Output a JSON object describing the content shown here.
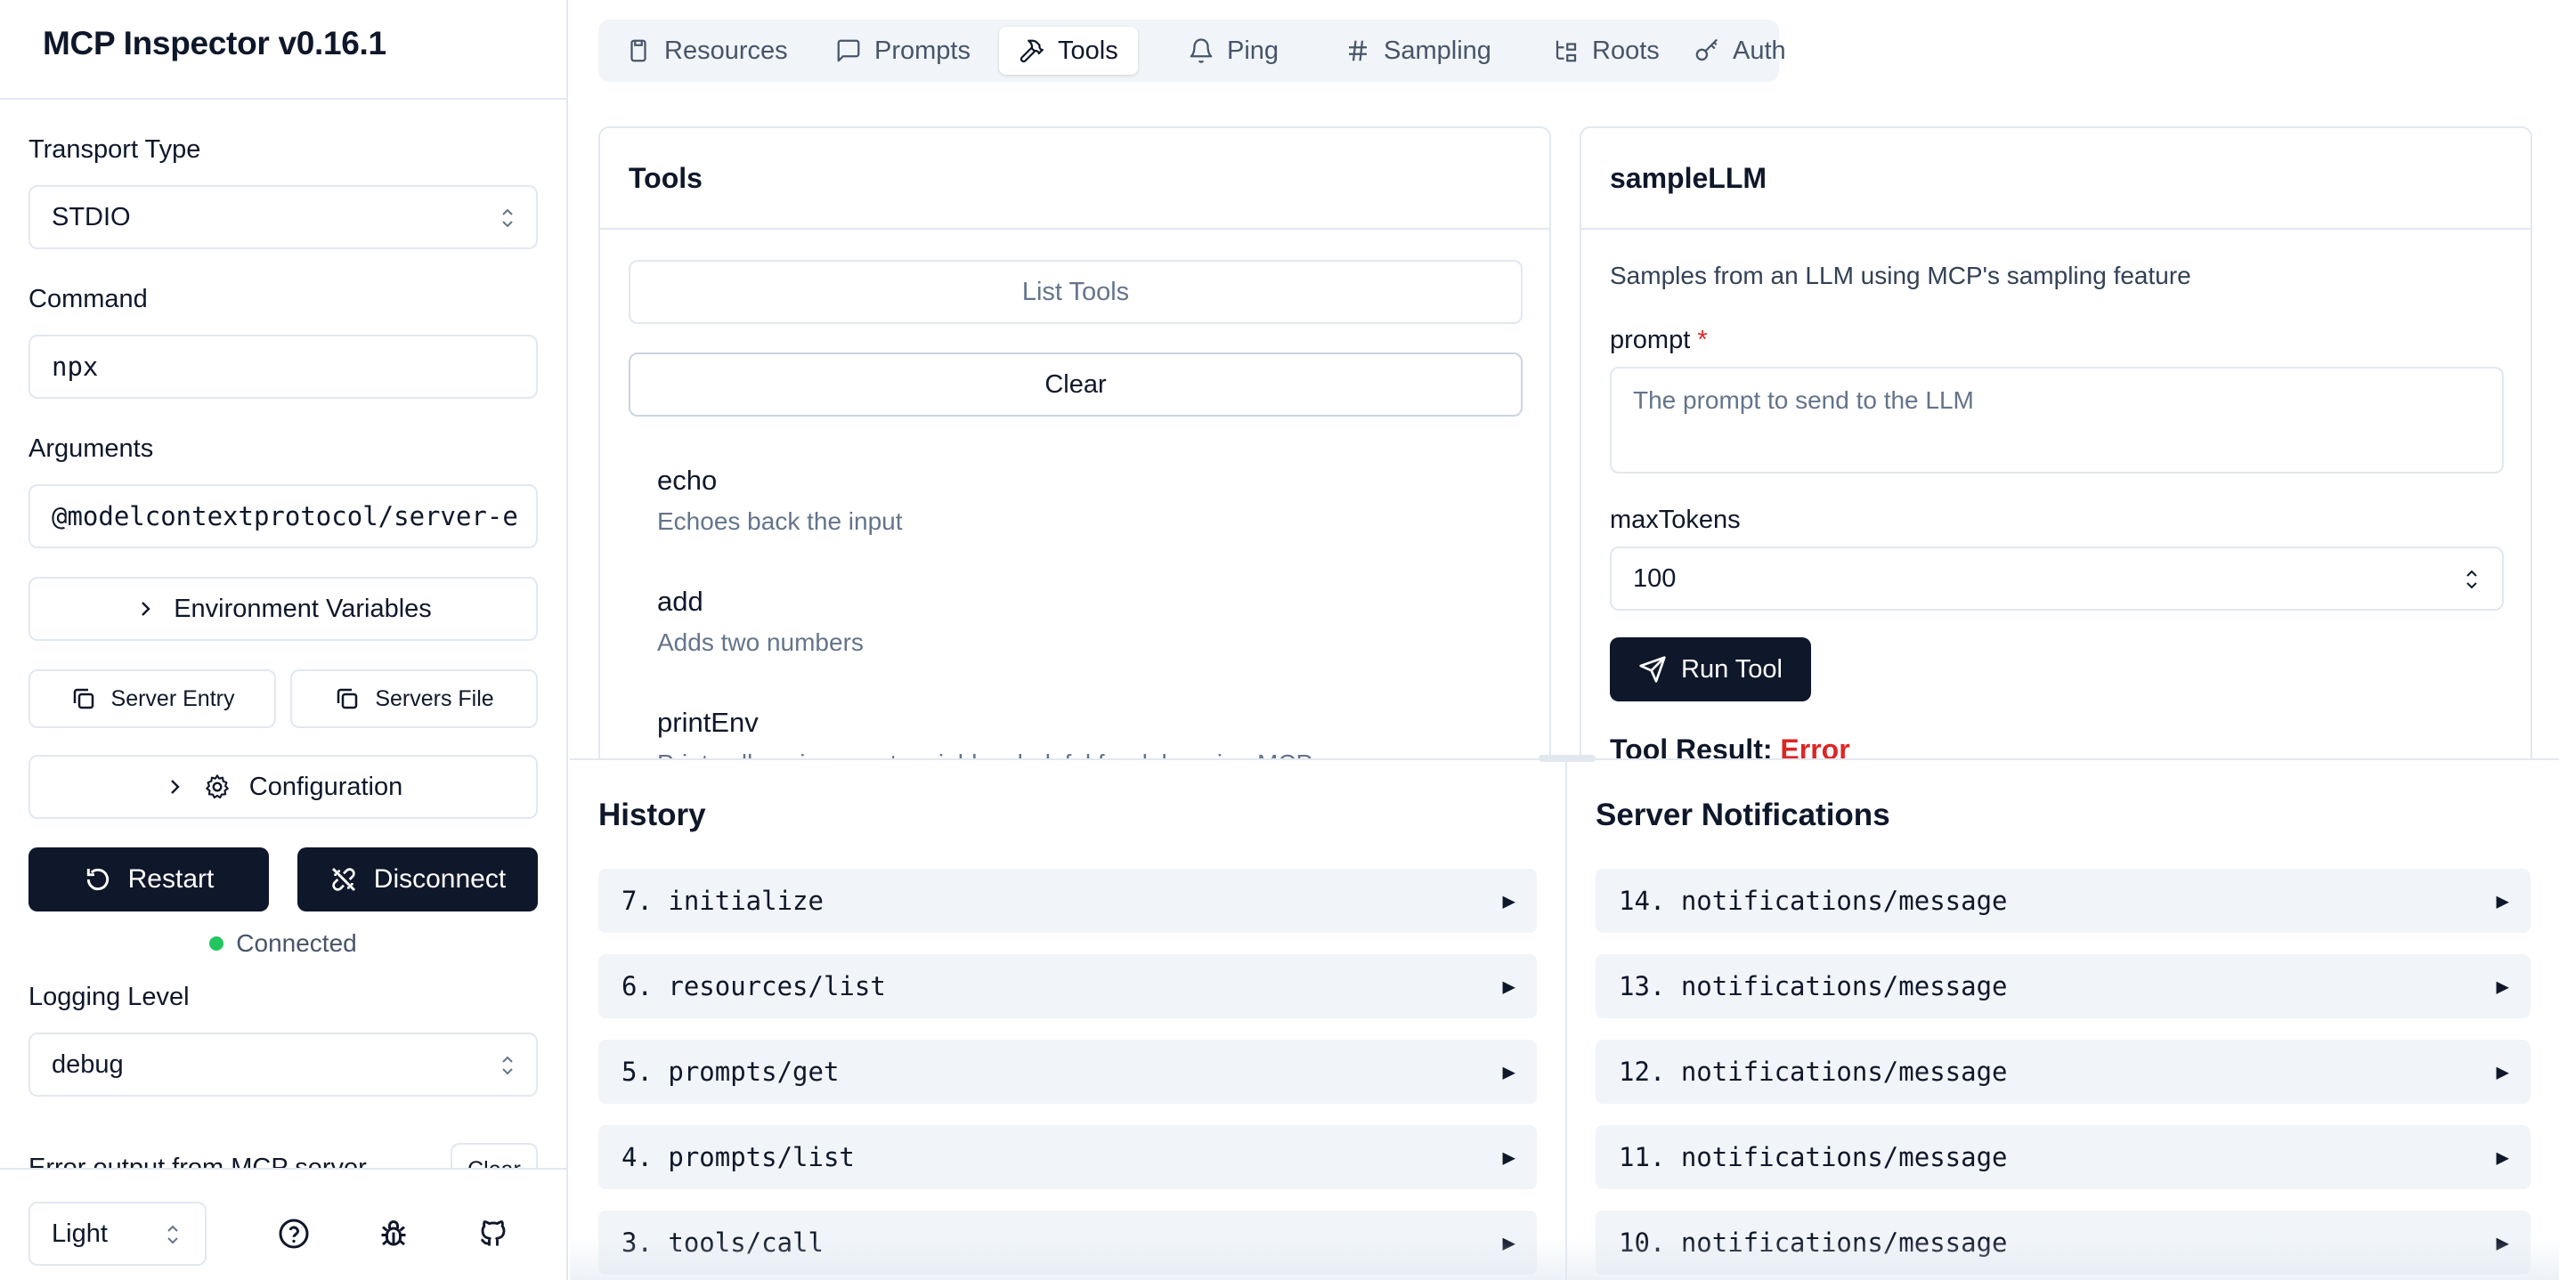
{
  "app": {
    "title": "MCP Inspector v0.16.1"
  },
  "sidebar": {
    "transport_label": "Transport Type",
    "transport_value": "STDIO",
    "command_label": "Command",
    "command_value": "npx",
    "arguments_label": "Arguments",
    "arguments_value": "@modelcontextprotocol/server-e",
    "env_button": "Environment Variables",
    "server_entry_button": "Server Entry",
    "servers_file_button": "Servers File",
    "config_button": "Configuration",
    "restart_button": "Restart",
    "disconnect_button": "Disconnect",
    "status_text": "Connected",
    "status_color": "#22c55e",
    "logging_label": "Logging Level",
    "logging_value": "debug",
    "error_output_label": "Error output from MCP server",
    "error_clear_button": "Clear",
    "theme_value": "Light",
    "footer_icons": [
      "help-icon",
      "bug-icon",
      "github-icon"
    ]
  },
  "tabs": [
    {
      "label": "Resources",
      "icon": "file-icon"
    },
    {
      "label": "Prompts",
      "icon": "message-icon"
    },
    {
      "label": "Tools",
      "icon": "hammer-icon",
      "active": true
    },
    {
      "label": "Ping",
      "icon": "bell-icon"
    },
    {
      "label": "Sampling",
      "icon": "hash-icon"
    },
    {
      "label": "Roots",
      "icon": "folder-tree-icon"
    },
    {
      "label": "Auth",
      "icon": "key-icon"
    }
  ],
  "tools_panel": {
    "title": "Tools",
    "list_button": "List Tools",
    "clear_button": "Clear",
    "items": [
      {
        "name": "echo",
        "description": "Echoes back the input"
      },
      {
        "name": "add",
        "description": "Adds two numbers"
      },
      {
        "name": "printEnv",
        "description": "Prints all environment variables, helpful for debugging MCP server"
      }
    ]
  },
  "tool_detail": {
    "title": "sampleLLM",
    "description": "Samples from an LLM using MCP's sampling feature",
    "prompt_label": "prompt",
    "required_mark": "*",
    "prompt_placeholder": "The prompt to send to the LLM",
    "max_tokens_label": "maxTokens",
    "max_tokens_value": "100",
    "run_button": "Run Tool",
    "result_label": "Tool Result:",
    "result_status": "Error",
    "error_color": "#dc2626"
  },
  "history": {
    "title": "History",
    "items": [
      "7. initialize",
      "6. resources/list",
      "5. prompts/get",
      "4. prompts/list",
      "3. tools/call"
    ]
  },
  "notifications": {
    "title": "Server Notifications",
    "items": [
      "14. notifications/message",
      "13. notifications/message",
      "12. notifications/message",
      "11. notifications/message",
      "10. notifications/message"
    ]
  },
  "expand_glyph": "▶"
}
